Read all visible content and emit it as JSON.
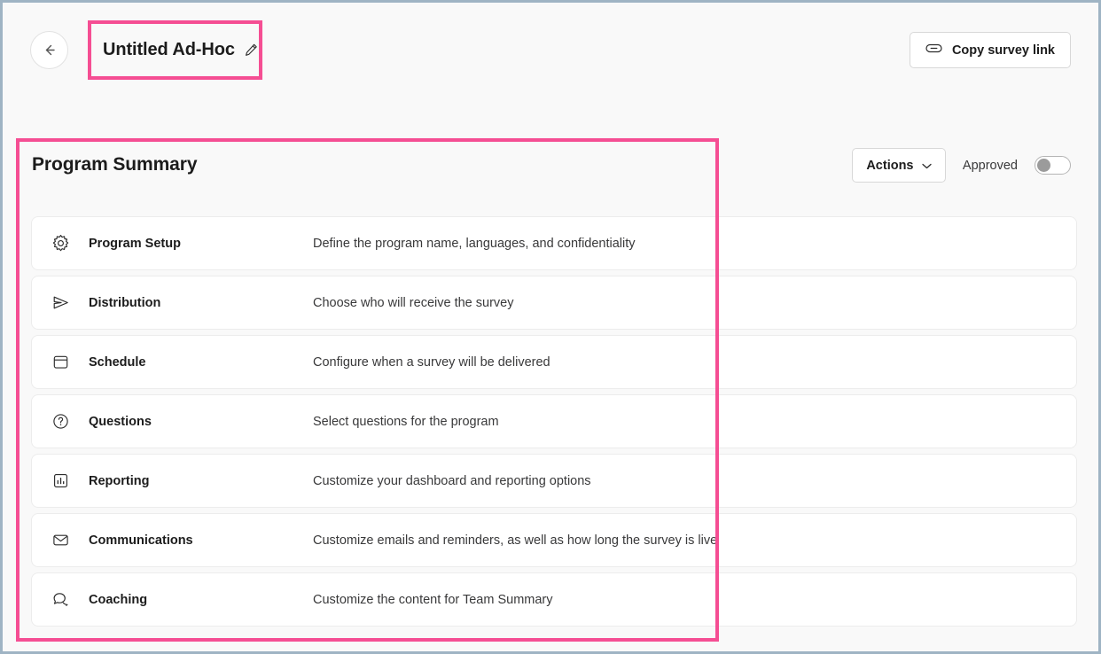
{
  "window": {
    "background_color": "#f9f9f9",
    "border_color": "#9fb4c4",
    "annotation_color": "#f54e93"
  },
  "header": {
    "back_button_icon": "arrow-left-icon",
    "title": "Untitled Ad-Hoc",
    "edit_icon": "pencil-icon",
    "copy_link": {
      "icon": "link-icon",
      "label": "Copy survey link"
    }
  },
  "summary": {
    "heading": "Program Summary",
    "actions": {
      "label": "Actions",
      "chevron_icon": "chevron-down-icon"
    },
    "approved": {
      "label": "Approved",
      "state": "off"
    },
    "rows": [
      {
        "icon": "gear-icon",
        "label": "Program Setup",
        "description": "Define the program name, languages, and confidentiality"
      },
      {
        "icon": "send-icon",
        "label": "Distribution",
        "description": "Choose who will receive the survey"
      },
      {
        "icon": "calendar-icon",
        "label": "Schedule",
        "description": "Configure when a survey will be delivered"
      },
      {
        "icon": "question-circle-icon",
        "label": "Questions",
        "description": "Select questions for the program"
      },
      {
        "icon": "bar-chart-icon",
        "label": "Reporting",
        "description": "Customize your dashboard and reporting options"
      },
      {
        "icon": "envelope-icon",
        "label": "Communications",
        "description": "Customize emails and reminders, as well as how long the survey is live"
      },
      {
        "icon": "chat-bubbles-icon",
        "label": "Coaching",
        "description": "Customize the content for Team Summary"
      }
    ]
  }
}
